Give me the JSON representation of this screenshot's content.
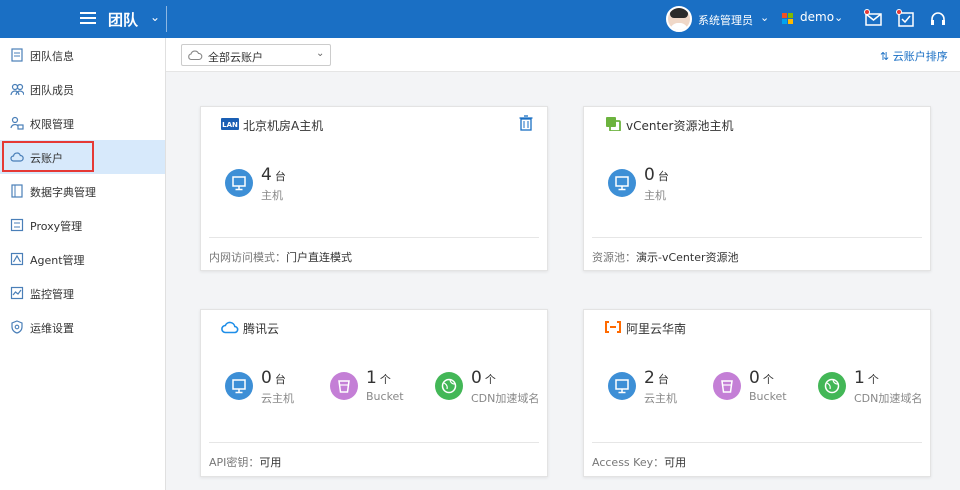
{
  "header": {
    "team_title": "团队",
    "user_name": "系统管理员",
    "org_name": "demo",
    "colors": {
      "bar": "#1a6fc4",
      "notification_dot": "#e53935"
    }
  },
  "sidebar": {
    "items": [
      {
        "label": "团队信息",
        "icon": "document-icon"
      },
      {
        "label": "团队成员",
        "icon": "users-icon"
      },
      {
        "label": "权限管理",
        "icon": "user-lock-icon"
      },
      {
        "label": "云账户",
        "icon": "cloud-icon",
        "active": true
      },
      {
        "label": "数据字典管理",
        "icon": "book-icon"
      },
      {
        "label": "Proxy管理",
        "icon": "proxy-icon"
      },
      {
        "label": "Agent管理",
        "icon": "agent-icon"
      },
      {
        "label": "监控管理",
        "icon": "monitor-chart-icon"
      },
      {
        "label": "运维设置",
        "icon": "shield-gear-icon"
      }
    ]
  },
  "toolbar": {
    "account_select": "全部云账户",
    "sort_label": "云账户排序"
  },
  "cards": [
    {
      "title": "北京机房A主机",
      "icon": "lan-icon",
      "stats": [
        {
          "value": "4",
          "unit": "台",
          "label": "主机",
          "color": "#3d8fd6"
        }
      ],
      "footer_key": "内网访问模式：",
      "footer_value": "门户直连模式"
    },
    {
      "title": "vCenter资源池主机",
      "icon": "vcenter-icon",
      "stats": [
        {
          "value": "0",
          "unit": "台",
          "label": "主机",
          "color": "#3d8fd6"
        }
      ],
      "footer_key": "资源池：",
      "footer_value": "演示-vCenter资源池"
    },
    {
      "title": "腾讯云",
      "icon": "tencent-cloud-icon",
      "stats": [
        {
          "value": "0",
          "unit": "台",
          "label": "云主机",
          "color": "#3d8fd6"
        },
        {
          "value": "1",
          "unit": "个",
          "label": "Bucket",
          "color": "#c47fd6"
        },
        {
          "value": "0",
          "unit": "个",
          "label": "CDN加速域名",
          "color": "#43b757"
        }
      ],
      "footer_key": "API密钥：",
      "footer_value": "可用"
    },
    {
      "title": "阿里云华南",
      "icon": "aliyun-icon",
      "stats": [
        {
          "value": "2",
          "unit": "台",
          "label": "云主机",
          "color": "#3d8fd6"
        },
        {
          "value": "0",
          "unit": "个",
          "label": "Bucket",
          "color": "#c47fd6"
        },
        {
          "value": "1",
          "unit": "个",
          "label": "CDN加速域名",
          "color": "#43b757"
        }
      ],
      "footer_key": "Access Key：",
      "footer_value": "可用"
    }
  ]
}
